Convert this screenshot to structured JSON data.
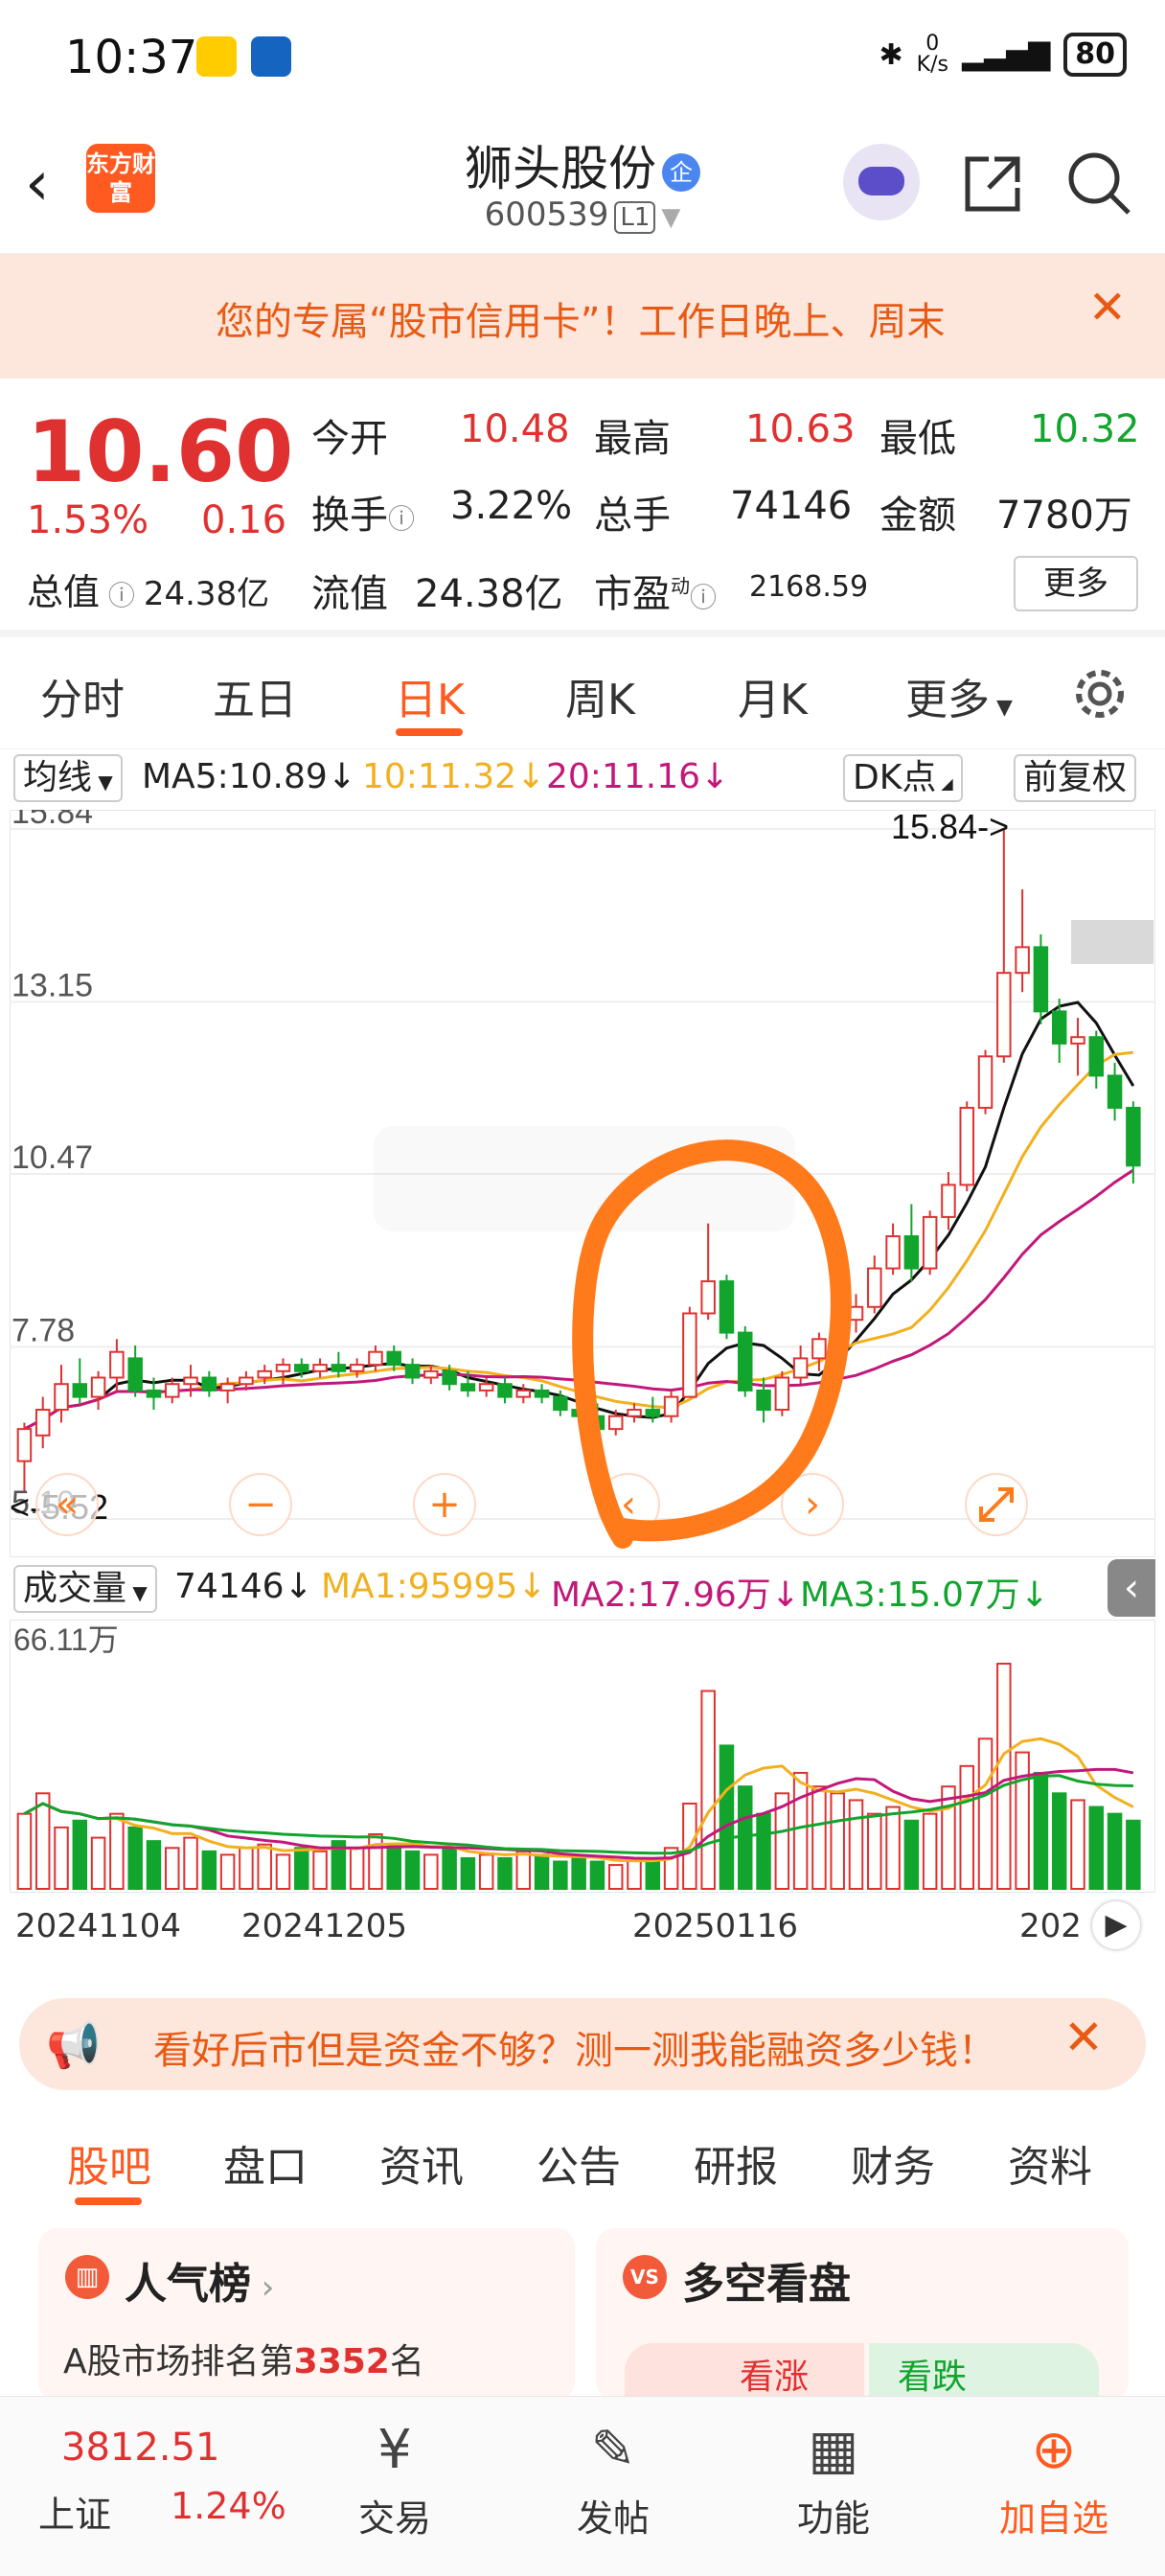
{
  "status_bar": {
    "time": "10:37",
    "net_speed": "0",
    "net_unit": "K/s",
    "battery": "80"
  },
  "header": {
    "logo_text": "东方财富",
    "stock_name": "狮头股份",
    "badge": "企",
    "stock_code": "600539",
    "level": "L1"
  },
  "promo": {
    "text": "您的专属“股市信用卡”！工作日晚上、周末"
  },
  "quote": {
    "price": "10.60",
    "change_pct": "1.53%",
    "change": "0.16",
    "open_label": "今开",
    "open": "10.48",
    "high_label": "最高",
    "high": "10.63",
    "low_label": "最低",
    "low": "10.32",
    "turnover_label": "换手",
    "turnover": "3.22%",
    "volume_label": "总手",
    "volume": "74146",
    "amount_label": "金额",
    "amount": "7780万",
    "mktcap_label": "总值",
    "mktcap": "24.38亿",
    "float_label": "流值",
    "float": "24.38亿",
    "pe_label": "市盈",
    "pe_sup": "动",
    "pe": "2168.59",
    "more_label": "更多"
  },
  "tabs": [
    "分时",
    "五日",
    "日K",
    "周K",
    "月K",
    "更多"
  ],
  "ma_row": {
    "ma_select": "均线",
    "ma5": "MA5:10.89↓",
    "ma10": "10:11.32↓",
    "ma20": "20:11.16↓",
    "dk": "DK点",
    "adjust": "前复权"
  },
  "chart_data": {
    "type": "candlestick",
    "y_ticks": [
      "15.84",
      "13.15",
      "10.47",
      "7.78",
      "5.10"
    ],
    "ylim": [
      5.1,
      15.84
    ],
    "max_marker": "15.84->",
    "min_marker": "<-5.52",
    "x_ticks": [
      "20241104",
      "20241205",
      "20250116",
      "202"
    ],
    "volume_label": "成交量",
    "volume_value": "74146↓",
    "vol_ma1": "MA1:95995↓",
    "vol_ma2": "MA2:17.96万↓",
    "vol_ma3": "MA3:15.07万↓",
    "volume_max": "66.11万",
    "candles": [
      [
        6.0,
        6.6,
        5.52,
        6.5
      ],
      [
        6.4,
        7.0,
        6.2,
        6.8
      ],
      [
        6.8,
        7.5,
        6.6,
        7.2
      ],
      [
        7.2,
        7.6,
        6.9,
        7.0
      ],
      [
        7.0,
        7.4,
        6.8,
        7.3
      ],
      [
        7.3,
        7.9,
        7.1,
        7.7
      ],
      [
        7.6,
        7.8,
        7.0,
        7.1
      ],
      [
        7.1,
        7.3,
        6.8,
        7.0
      ],
      [
        7.0,
        7.3,
        6.9,
        7.2
      ],
      [
        7.2,
        7.5,
        7.0,
        7.3
      ],
      [
        7.3,
        7.4,
        7.0,
        7.1
      ],
      [
        7.1,
        7.3,
        6.9,
        7.2
      ],
      [
        7.2,
        7.4,
        7.1,
        7.3
      ],
      [
        7.3,
        7.5,
        7.2,
        7.4
      ],
      [
        7.4,
        7.6,
        7.2,
        7.5
      ],
      [
        7.5,
        7.6,
        7.3,
        7.4
      ],
      [
        7.4,
        7.6,
        7.3,
        7.5
      ],
      [
        7.5,
        7.7,
        7.3,
        7.4
      ],
      [
        7.4,
        7.6,
        7.3,
        7.5
      ],
      [
        7.5,
        7.8,
        7.4,
        7.7
      ],
      [
        7.7,
        7.8,
        7.4,
        7.5
      ],
      [
        7.5,
        7.6,
        7.2,
        7.3
      ],
      [
        7.3,
        7.5,
        7.2,
        7.4
      ],
      [
        7.4,
        7.5,
        7.1,
        7.2
      ],
      [
        7.2,
        7.4,
        7.0,
        7.1
      ],
      [
        7.1,
        7.3,
        7.0,
        7.2
      ],
      [
        7.2,
        7.3,
        6.9,
        7.0
      ],
      [
        7.0,
        7.2,
        6.9,
        7.1
      ],
      [
        7.1,
        7.2,
        6.9,
        7.0
      ],
      [
        7.0,
        7.1,
        6.7,
        6.8
      ],
      [
        6.8,
        7.0,
        6.6,
        6.7
      ],
      [
        6.7,
        6.9,
        6.4,
        6.5
      ],
      [
        6.5,
        6.8,
        6.4,
        6.7
      ],
      [
        6.7,
        6.9,
        6.6,
        6.8
      ],
      [
        6.8,
        7.0,
        6.6,
        6.7
      ],
      [
        6.7,
        7.1,
        6.6,
        7.0
      ],
      [
        7.0,
        8.4,
        7.0,
        8.3
      ],
      [
        8.3,
        9.7,
        8.2,
        8.8
      ],
      [
        8.8,
        8.9,
        7.9,
        8.0
      ],
      [
        8.0,
        8.1,
        7.0,
        7.1
      ],
      [
        7.1,
        7.3,
        6.6,
        6.8
      ],
      [
        6.8,
        7.4,
        6.7,
        7.3
      ],
      [
        7.3,
        7.8,
        7.2,
        7.6
      ],
      [
        7.6,
        8.0,
        7.4,
        7.9
      ],
      [
        7.9,
        8.4,
        7.8,
        8.2
      ],
      [
        8.2,
        8.6,
        8.0,
        8.4
      ],
      [
        8.4,
        9.2,
        8.3,
        9.0
      ],
      [
        9.0,
        9.7,
        8.9,
        9.5
      ],
      [
        9.5,
        10.0,
        8.8,
        9.0
      ],
      [
        9.0,
        9.9,
        8.9,
        9.8
      ],
      [
        9.8,
        10.5,
        9.6,
        10.3
      ],
      [
        10.3,
        11.6,
        10.2,
        11.5
      ],
      [
        11.5,
        12.4,
        11.4,
        12.3
      ],
      [
        12.3,
        15.84,
        12.2,
        13.6
      ],
      [
        13.6,
        14.9,
        13.3,
        14.0
      ],
      [
        14.0,
        14.2,
        12.8,
        13.0
      ],
      [
        13.0,
        13.2,
        12.2,
        12.5
      ],
      [
        12.5,
        12.9,
        12.0,
        12.6
      ],
      [
        12.6,
        12.7,
        11.8,
        12.0
      ],
      [
        12.0,
        12.2,
        11.3,
        11.5
      ],
      [
        11.5,
        11.6,
        10.32,
        10.6
      ]
    ],
    "volumes": [
      22,
      28,
      18,
      20,
      15,
      22,
      18,
      14,
      12,
      15,
      11,
      10,
      12,
      13,
      10,
      12,
      11,
      14,
      12,
      16,
      13,
      11,
      10,
      12,
      9,
      10,
      9,
      11,
      10,
      8,
      9,
      8,
      7,
      9,
      8,
      12,
      25,
      58,
      42,
      30,
      22,
      28,
      34,
      30,
      28,
      26,
      22,
      24,
      20,
      22,
      30,
      36,
      44,
      66,
      40,
      34,
      28,
      26,
      24,
      22,
      20
    ]
  },
  "nav_buttons": [
    "«",
    "−",
    "+",
    "‹",
    "›"
  ],
  "ad": {
    "text": "看好后市但是资金不够？测一测我能融资多少钱！"
  },
  "section_tabs": [
    "股吧",
    "盘口",
    "资讯",
    "公告",
    "研报",
    "财务",
    "资料"
  ],
  "cards": {
    "popularity_title": "人气榜",
    "popularity_text_prefix": "A股市场排名第",
    "popularity_rank": "3352",
    "popularity_text_suffix": "名",
    "vs_title": "多空看盘",
    "vs_up": "看涨",
    "vs_down": "看跌"
  },
  "bottom_bar": {
    "index_value": "3812.51",
    "index_name": "上证",
    "index_change": "1.24%",
    "trade": "交易",
    "post": "发帖",
    "functions": "功能",
    "add": "加自选"
  },
  "colors": {
    "up": "#e03131",
    "down": "#12a52d",
    "ma5": "#111111",
    "ma10": "#f2b01e",
    "ma20": "#c2187a",
    "accent": "#ff5a1f",
    "annotation": "#ff7a1a"
  }
}
